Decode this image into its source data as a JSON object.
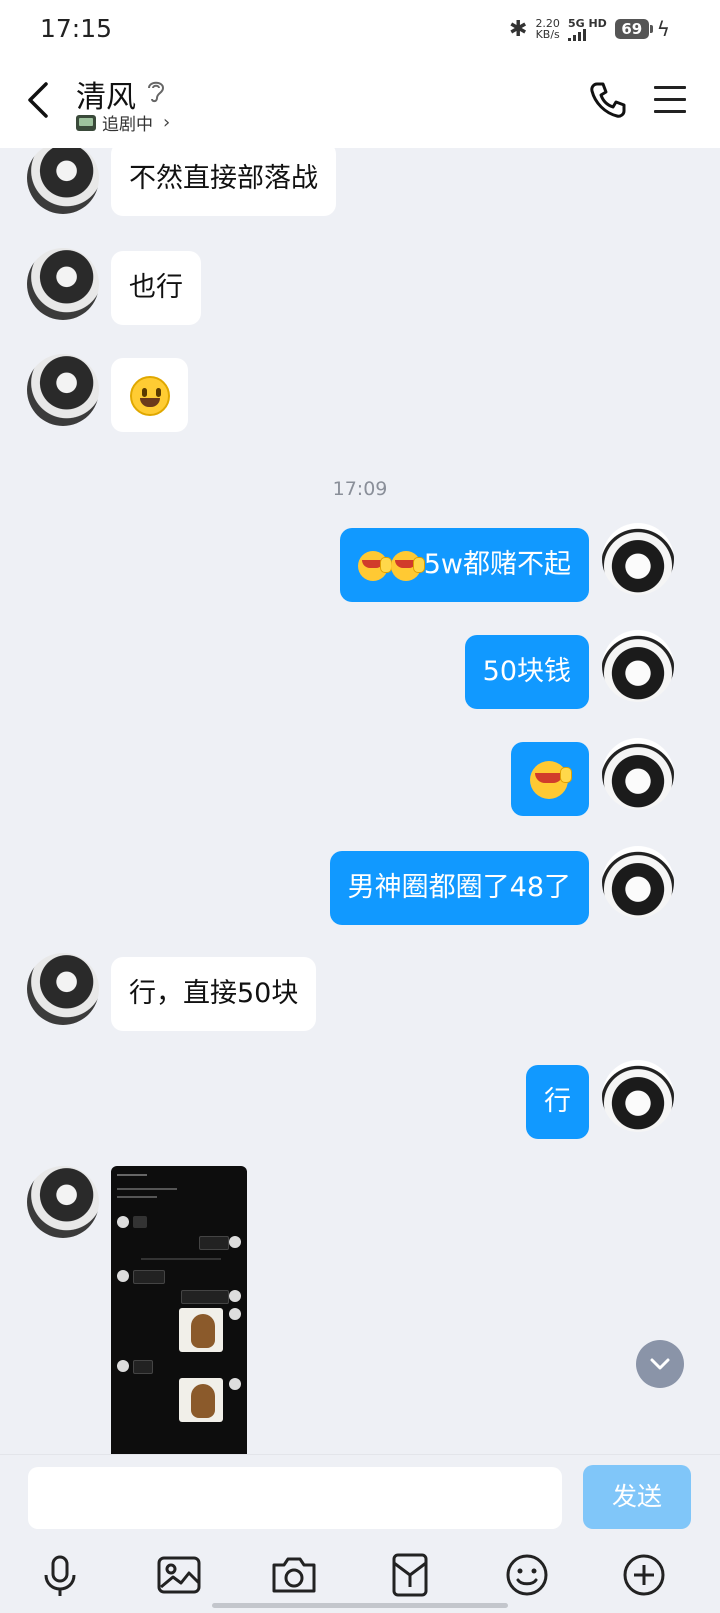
{
  "status": {
    "time": "17:15",
    "net_speed_value": "2.20",
    "net_speed_unit": "KB/s",
    "network": "5G HD",
    "battery": "69"
  },
  "header": {
    "title": "清风",
    "subtitle": "追剧中",
    "ear_icon": "ear-icon",
    "phone_icon": "phone-icon",
    "menu_icon": "menu-icon"
  },
  "messages": [
    {
      "side": "in",
      "text": "不然直接部落战"
    },
    {
      "side": "in",
      "text": "也行"
    },
    {
      "side": "in",
      "emoji": "smiley"
    },
    {
      "timestamp": "17:09"
    },
    {
      "side": "out",
      "text": "5w都赌不起",
      "prefix_emojis": 2
    },
    {
      "side": "out",
      "text": "50块钱"
    },
    {
      "side": "out",
      "emoji": "laughing-tear"
    },
    {
      "side": "out",
      "text": "男神圈都圈了48了"
    },
    {
      "side": "in",
      "text": "行，直接50块"
    },
    {
      "side": "out",
      "text": "行"
    },
    {
      "side": "in",
      "image": "chat-screenshot"
    }
  ],
  "input": {
    "value": "",
    "send_label": "发送"
  },
  "toolbar": [
    "mic-icon",
    "image-icon",
    "camera-icon",
    "red-packet-icon",
    "emoji-icon",
    "plus-icon"
  ]
}
